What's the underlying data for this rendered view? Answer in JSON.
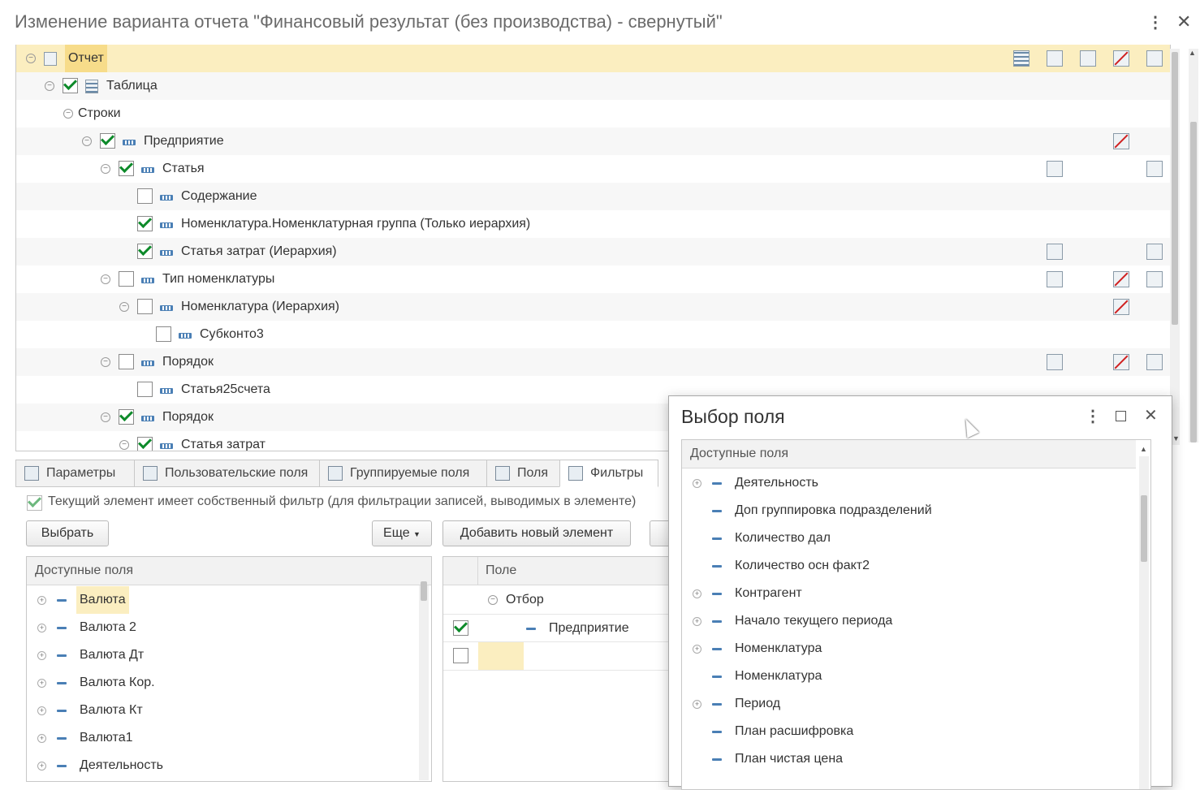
{
  "window": {
    "title": "Изменение варианта отчета \"Финансовый результат (без производства) - свернутый\""
  },
  "tree": {
    "rows": [
      {
        "label": "Отчет",
        "level": 0,
        "expander": true,
        "checkbox": null,
        "icon": "report-icon",
        "selected": true,
        "row_icons": [
          "structure-icon",
          "filter-icon",
          "order-icon",
          "conditional-format-icon",
          "settings-icon"
        ]
      },
      {
        "label": "Таблица",
        "level": 1,
        "expander": true,
        "checkbox": true,
        "icon": "table-icon"
      },
      {
        "label": "Строки",
        "level": 2,
        "expander": true,
        "checkbox": null,
        "icon": null
      },
      {
        "label": "Предприятие",
        "level": 3,
        "expander": true,
        "checkbox": true,
        "icon": "grouping-icon",
        "row_icons": [
          "conditional-format-icon"
        ]
      },
      {
        "label": "Статья",
        "level": 4,
        "expander": true,
        "checkbox": true,
        "icon": "grouping-icon",
        "row_icons": [
          "filter-icon",
          "settings-icon"
        ]
      },
      {
        "label": "Содержание",
        "level": 5,
        "expander": false,
        "checkbox": false,
        "icon": "grouping-icon"
      },
      {
        "label": "Номенклатура.Номенклатурная группа (Только иерархия)",
        "level": 5,
        "expander": false,
        "checkbox": true,
        "icon": "grouping-icon"
      },
      {
        "label": "Статья затрат (Иерархия)",
        "level": 5,
        "expander": false,
        "checkbox": true,
        "icon": "grouping-icon",
        "row_icons": [
          "filter-icon",
          "settings-icon"
        ]
      },
      {
        "label": "Тип номенклатуры",
        "level": 4,
        "expander": true,
        "checkbox": false,
        "icon": "grouping-icon",
        "row_icons": [
          "filter-icon",
          "conditional-format-icon",
          "settings-icon"
        ]
      },
      {
        "label": "Номенклатура (Иерархия)",
        "level": 5,
        "expander": true,
        "checkbox": false,
        "icon": "grouping-icon",
        "row_icons": [
          "conditional-format-icon"
        ]
      },
      {
        "label": "Субконто3",
        "level": 6,
        "expander": false,
        "checkbox": false,
        "icon": "grouping-icon"
      },
      {
        "label": "Порядок",
        "level": 4,
        "expander": true,
        "checkbox": false,
        "icon": "grouping-icon",
        "row_icons": [
          "filter-icon",
          "conditional-format-icon",
          "settings-icon"
        ]
      },
      {
        "label": "Статья25счета",
        "level": 5,
        "expander": false,
        "checkbox": false,
        "icon": "grouping-icon"
      },
      {
        "label": "Порядок",
        "level": 4,
        "expander": true,
        "checkbox": true,
        "icon": "grouping-icon"
      },
      {
        "label": "Статья затрат",
        "level": 5,
        "expander": true,
        "checkbox": true,
        "icon": "grouping-icon"
      }
    ]
  },
  "tabs": [
    {
      "label": "Параметры",
      "icon": "parameters-icon"
    },
    {
      "label": "Пользовательские поля",
      "icon": "user-fields-icon"
    },
    {
      "label": "Группируемые поля",
      "icon": "grouped-fields-icon"
    },
    {
      "label": "Поля",
      "icon": "fields-icon"
    },
    {
      "label": "Фильтры",
      "icon": "filter-icon",
      "active": true
    }
  ],
  "filters": {
    "own_filter_label": "Текущий элемент имеет собственный фильтр (для фильтрации записей, выводимых в элементе)",
    "own_filter_checked": true,
    "select_button": "Выбрать",
    "more_button": "Еще",
    "add_new_button": "Добавить новый элемент",
    "available_fields_header": "Доступные поля",
    "available_fields": [
      {
        "label": "Валюта",
        "selected": true
      },
      {
        "label": "Валюта 2"
      },
      {
        "label": "Валюта Дт"
      },
      {
        "label": "Валюта Кор."
      },
      {
        "label": "Валюта Кт"
      },
      {
        "label": "Валюта1"
      },
      {
        "label": "Деятельность"
      }
    ],
    "field_column_header": "Поле",
    "filter_root": "Отбор",
    "filter_items": [
      {
        "label": "Предприятие",
        "checked": true
      }
    ]
  },
  "dialog": {
    "title": "Выбор поля",
    "header": "Доступные поля",
    "items": [
      {
        "label": "Деятельность",
        "expandable": true
      },
      {
        "label": "Доп группировка подразделений",
        "expandable": false
      },
      {
        "label": "Количество дал",
        "expandable": false
      },
      {
        "label": "Количество осн факт2",
        "expandable": false
      },
      {
        "label": "Контрагент",
        "expandable": true
      },
      {
        "label": "Начало текущего периода",
        "expandable": true
      },
      {
        "label": "Номенклатура",
        "expandable": true
      },
      {
        "label": "Номенклатура",
        "expandable": false
      },
      {
        "label": "Период",
        "expandable": true
      },
      {
        "label": "План расшифровка",
        "expandable": false
      },
      {
        "label": "План чистая цена",
        "expandable": false
      }
    ]
  },
  "colors": {
    "selected_row": "#fbeec0",
    "check_green": "#0d8a2a",
    "field_icon_blue": "#4a7fb5"
  }
}
